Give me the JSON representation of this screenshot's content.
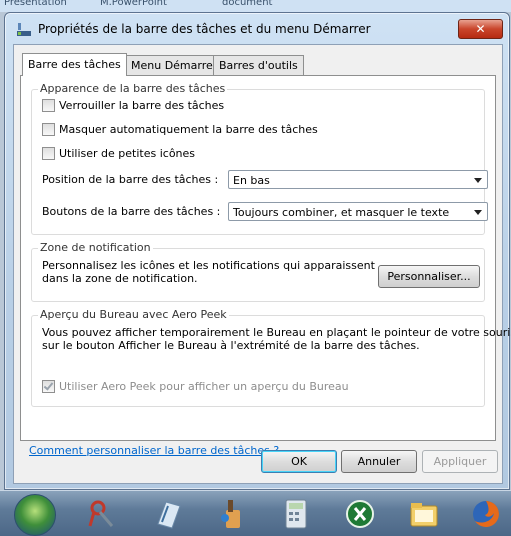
{
  "background_strip": {
    "fragments": [
      "Présentation",
      "M.PowerPoint",
      "document"
    ]
  },
  "window": {
    "title": "Propriétés de la barre des tâches et du menu Démarrer",
    "close_label": "✕",
    "tabs": [
      {
        "label": "Barre des tâches",
        "active": true
      },
      {
        "label": "Menu Démarrer",
        "active": false
      },
      {
        "label": "Barres d'outils",
        "active": false
      }
    ]
  },
  "appearance": {
    "title": "Apparence de la barre des tâches",
    "options": [
      {
        "label": "Verrouiller la barre des tâches",
        "checked": false
      },
      {
        "label": "Masquer automatiquement la barre des tâches",
        "checked": false
      },
      {
        "label": "Utiliser de petites icônes",
        "checked": false
      }
    ],
    "position_label": "Position de la barre des tâches :",
    "position_value": "En bas",
    "buttons_label": "Boutons de la barre des tâches :",
    "buttons_value": "Toujours combiner, et masquer le texte"
  },
  "notification": {
    "title": "Zone de notification",
    "text_line1": "Personnalisez les icônes et les notifications qui apparaissent",
    "text_line2": "dans la zone de notification.",
    "customize_label": "Personnaliser..."
  },
  "aero_peek": {
    "title": "Aperçu du Bureau avec Aero Peek",
    "text_line1": "Vous pouvez afficher temporairement le Bureau en plaçant le pointeur de votre souris",
    "text_line2": "sur le bouton Afficher le Bureau à l'extrémité de la barre des tâches.",
    "option_label": "Utiliser Aero Peek pour afficher un aperçu du Bureau",
    "option_checked": true,
    "option_disabled": true
  },
  "help_link": "Comment personnaliser la barre des tâches ?",
  "footer": {
    "ok_label": "OK",
    "cancel_label": "Annuler",
    "apply_label": "Appliquer"
  },
  "taskbar": {
    "icons": [
      "start-orb-icon",
      "paint-icon",
      "notepad-icon",
      "paint-brush-icon",
      "calculator-icon",
      "excel-icon",
      "explorer-folder-icon",
      "firefox-icon"
    ]
  }
}
